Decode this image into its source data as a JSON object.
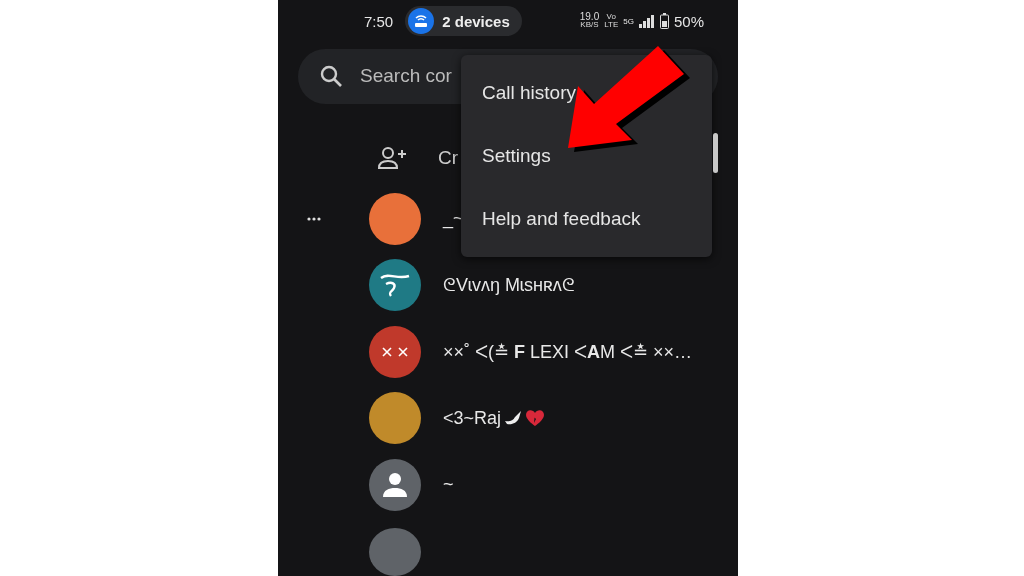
{
  "status_bar": {
    "time": "7:50",
    "hotspot": "2 devices",
    "speed": "19.0",
    "speed_unit": "KB/S",
    "volte_top": "Vo",
    "volte_bottom": "LTE",
    "network": "5G",
    "battery": "50%"
  },
  "search": {
    "placeholder": "Search cor"
  },
  "create_contact": {
    "label": "Cr"
  },
  "menu": {
    "items": [
      {
        "label": "Call history"
      },
      {
        "label": "Settings"
      },
      {
        "label": "Help and feedback"
      }
    ]
  },
  "contacts": [
    {
      "name": "_~",
      "kind": "photo",
      "more": true
    },
    {
      "name": "ᘓVɩvʌŋ Mɩsʜʀʌᘓ",
      "kind": "letter",
      "color": "#1f7a85"
    },
    {
      "name": "××˚ ᐸ(≛ **F** LEXI ᐸ**A**M ᐸ≛ ××…",
      "kind": "cross",
      "color": "#c0392b"
    },
    {
      "name": "<3~Raj",
      "kind": "photo",
      "emoji": true
    },
    {
      "name": "~",
      "kind": "person",
      "color": "#5f6368"
    }
  ]
}
